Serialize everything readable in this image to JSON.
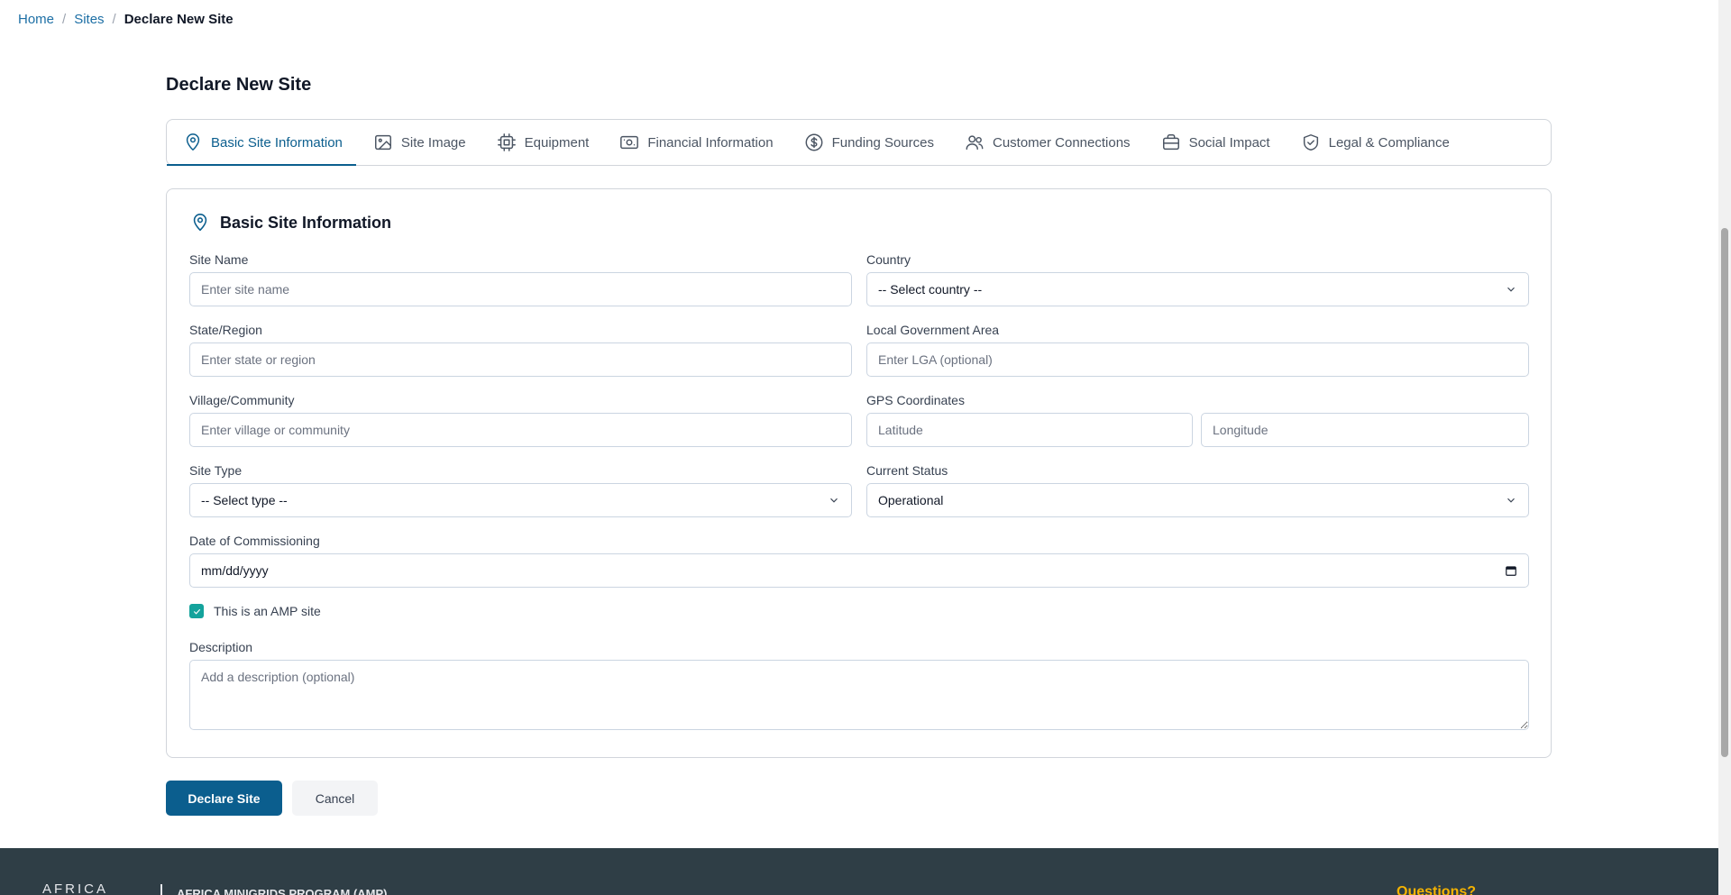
{
  "breadcrumb": {
    "home": "Home",
    "sites": "Sites",
    "current": "Declare New Site",
    "separator": "/"
  },
  "page": {
    "title": "Declare New Site"
  },
  "tabs": [
    {
      "label": "Basic Site Information",
      "icon": "map-pin-icon",
      "active": true
    },
    {
      "label": "Site Image",
      "icon": "image-icon",
      "active": false
    },
    {
      "label": "Equipment",
      "icon": "chip-icon",
      "active": false
    },
    {
      "label": "Financial Information",
      "icon": "banknote-icon",
      "active": false
    },
    {
      "label": "Funding Sources",
      "icon": "dollar-circle-icon",
      "active": false
    },
    {
      "label": "Customer Connections",
      "icon": "users-icon",
      "active": false
    },
    {
      "label": "Social Impact",
      "icon": "briefcase-icon",
      "active": false
    },
    {
      "label": "Legal & Compliance",
      "icon": "shield-check-icon",
      "active": false
    }
  ],
  "form": {
    "section_title": "Basic Site Information",
    "site_name": {
      "label": "Site Name",
      "placeholder": "Enter site name",
      "value": ""
    },
    "country": {
      "label": "Country",
      "value": "-- Select country --"
    },
    "state": {
      "label": "State/Region",
      "placeholder": "Enter state or region",
      "value": ""
    },
    "lga": {
      "label": "Local Government Area",
      "placeholder": "Enter LGA (optional)",
      "value": ""
    },
    "village": {
      "label": "Village/Community",
      "placeholder": "Enter village or community",
      "value": ""
    },
    "gps": {
      "label": "GPS Coordinates",
      "lat_placeholder": "Latitude",
      "lng_placeholder": "Longitude"
    },
    "site_type": {
      "label": "Site Type",
      "value": "-- Select type --"
    },
    "status": {
      "label": "Current Status",
      "value": "Operational"
    },
    "commissioning": {
      "label": "Date of Commissioning",
      "value": "mm/dd/yyyy"
    },
    "amp_site": {
      "label": "This is an AMP site",
      "checked": true
    },
    "description": {
      "label": "Description",
      "placeholder": "Add a description (optional)"
    }
  },
  "actions": {
    "submit": "Declare Site",
    "cancel": "Cancel"
  },
  "footer": {
    "logo": "AFRICA",
    "program": "AFRICA MINIGRIDS PROGRAM (AMP)",
    "questions": "Questions?"
  },
  "colors": {
    "primary": "#0b5e8e",
    "checkbox": "#14a39c",
    "footer_bg": "#2f3e46",
    "accent": "#f5b301"
  }
}
